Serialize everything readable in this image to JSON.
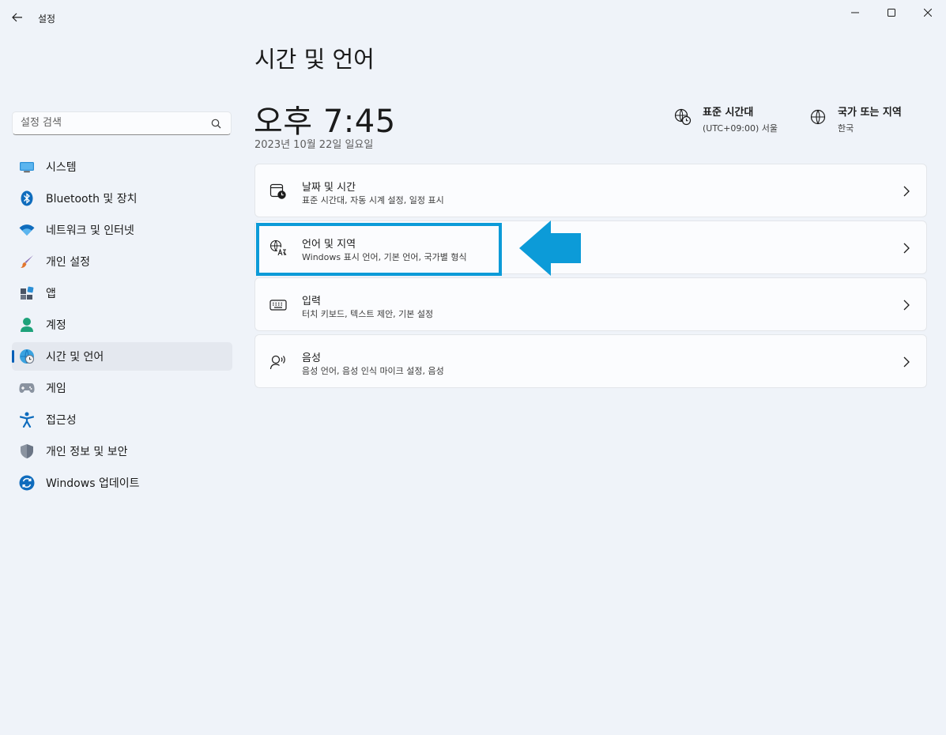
{
  "window": {
    "title": "설정"
  },
  "search": {
    "placeholder": "설정 검색"
  },
  "sidebar": {
    "items": [
      {
        "label": "시스템",
        "icon": "system-icon"
      },
      {
        "label": "Bluetooth 및 장치",
        "icon": "bluetooth-icon"
      },
      {
        "label": "네트워크 및 인터넷",
        "icon": "wifi-icon"
      },
      {
        "label": "개인 설정",
        "icon": "brush-icon"
      },
      {
        "label": "앱",
        "icon": "apps-icon"
      },
      {
        "label": "계정",
        "icon": "account-icon"
      },
      {
        "label": "시간 및 언어",
        "icon": "time-language-icon",
        "active": true
      },
      {
        "label": "게임",
        "icon": "gamepad-icon"
      },
      {
        "label": "접근성",
        "icon": "accessibility-icon"
      },
      {
        "label": "개인 정보 및 보안",
        "icon": "shield-icon"
      },
      {
        "label": "Windows 업데이트",
        "icon": "update-icon"
      }
    ]
  },
  "main": {
    "title": "시간 및 언어",
    "time": "오후 7:45",
    "date": "2023년 10월 22일 일요일",
    "timezone": {
      "title": "표준 시간대",
      "value": "(UTC+09:00) 서울",
      "icon": "timezone-globe-icon"
    },
    "region": {
      "title": "국가 또는 지역",
      "value": "한국",
      "icon": "globe-icon"
    },
    "cards": [
      {
        "title": "날짜 및 시간",
        "subtitle": "표준 시간대, 자동 시계 설정, 일정 표시",
        "icon": "calendar-clock-icon"
      },
      {
        "title": "언어 및 지역",
        "subtitle": "Windows 표시 언어, 기본 언어, 국가별 형식",
        "icon": "language-icon"
      },
      {
        "title": "입력",
        "subtitle": "터치 키보드, 텍스트 제안, 기본 설정",
        "icon": "keyboard-icon"
      },
      {
        "title": "음성",
        "subtitle": "음성 언어, 음성 인식 마이크 설정, 음성",
        "icon": "speech-icon"
      }
    ]
  },
  "colors": {
    "accent": "#005fb8",
    "highlight": "#0c9bd8",
    "background": "#eff3f9",
    "card": "#fbfcfe"
  }
}
